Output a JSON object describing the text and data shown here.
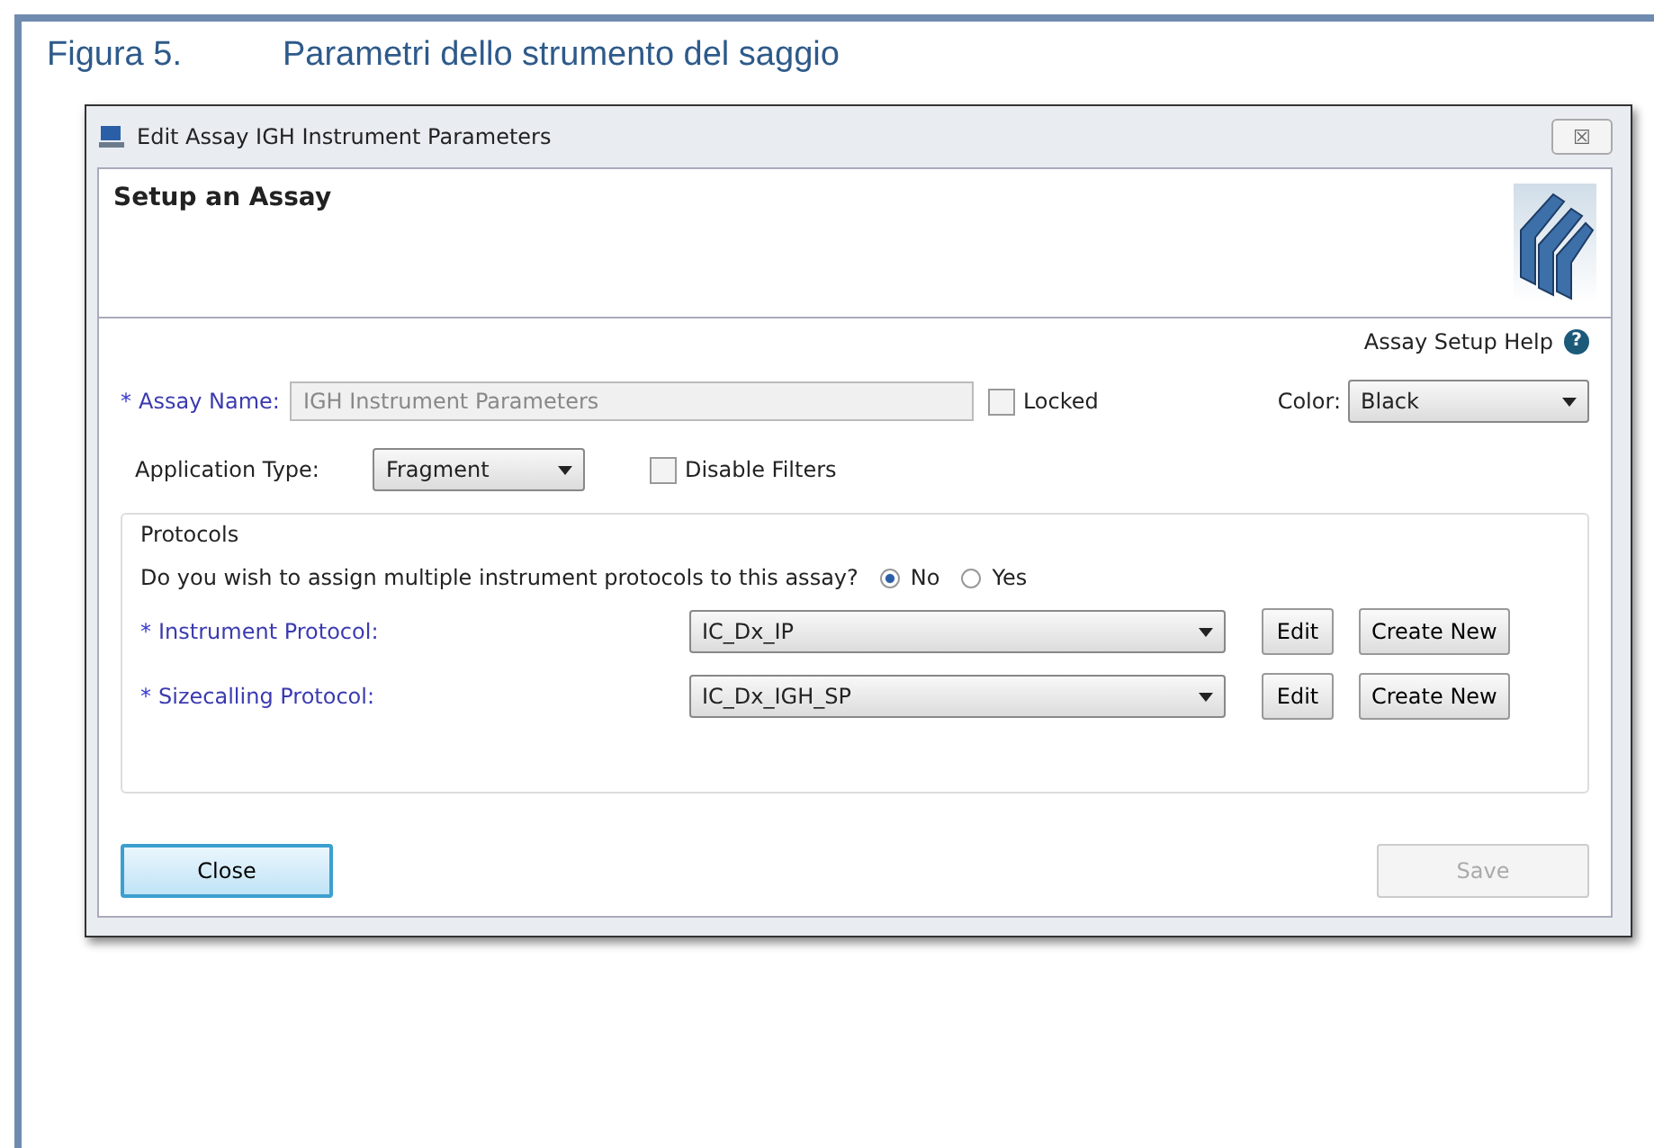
{
  "figure": {
    "number": "Figura 5.",
    "caption": "Parametri dello strumento del saggio"
  },
  "window": {
    "title": "Edit Assay IGH Instrument Parameters",
    "close": "☒"
  },
  "header": {
    "title": "Setup an Assay"
  },
  "help": {
    "label": "Assay Setup Help",
    "icon": "?"
  },
  "assay_name": {
    "required": "*",
    "label": "Assay Name:",
    "value": "IGH Instrument Parameters",
    "disabled": true
  },
  "locked": {
    "label": "Locked",
    "checked": false
  },
  "color": {
    "label": "Color:",
    "value": "Black"
  },
  "application_type": {
    "label": "Application Type:",
    "value": "Fragment"
  },
  "disable_filters": {
    "label": "Disable Filters",
    "checked": false
  },
  "protocols": {
    "title": "Protocols",
    "question": "Do you wish to assign multiple instrument protocols to this assay?",
    "options": [
      {
        "label": "No",
        "selected": true
      },
      {
        "label": "Yes",
        "selected": false
      }
    ],
    "rows": [
      {
        "required": "*",
        "label": "Instrument Protocol:",
        "value": "IC_Dx_IP",
        "edit": "Edit",
        "create": "Create New"
      },
      {
        "required": "*",
        "label": "Sizecalling Protocol:",
        "value": "IC_Dx_IGH_SP",
        "edit": "Edit",
        "create": "Create New"
      }
    ]
  },
  "buttons": [
    {
      "label": "Close",
      "disabled": false
    },
    {
      "label": "Save",
      "disabled": true
    }
  ]
}
